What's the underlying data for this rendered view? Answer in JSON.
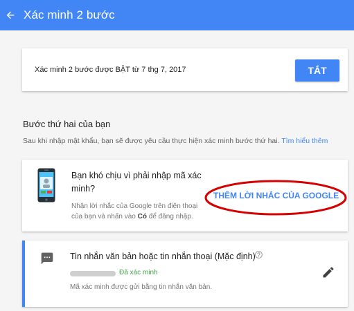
{
  "header": {
    "title": "Xác minh 2 bước",
    "color": "#4285f4"
  },
  "status": {
    "text": "Xác minh 2 bước được BẬT từ 7 thg 7, 2017",
    "button_label": "TẮT"
  },
  "second_step": {
    "title": "Bước thứ hai của bạn",
    "description": "Sau khi nhập mật khẩu, bạn sẽ được yêu cầu thực hiện xác minh bước thứ hai.",
    "learn_more": "Tìm hiểu thêm"
  },
  "google_prompt": {
    "heading": "Bạn khó chịu vì phải nhập mã xác minh?",
    "desc_before": "Nhận lời nhắc của Google trên điện thoại của bạn và nhấn vào ",
    "desc_bold": "Có",
    "desc_after": " để đăng nhập.",
    "button_label": "THÊM LỜI NHẮC CỦA GOOGLE",
    "icon": "phone-icon",
    "highlight_color": "#d50000"
  },
  "sms": {
    "heading": "Tin nhắn văn bản hoặc tin nhắn thoại (Mặc định)",
    "verified": "Đã xác minh",
    "subtitle": "Mã xác minh được gửi bằng tin nhắn văn bản.",
    "icon": "message-icon",
    "verified_color": "#43a047"
  }
}
